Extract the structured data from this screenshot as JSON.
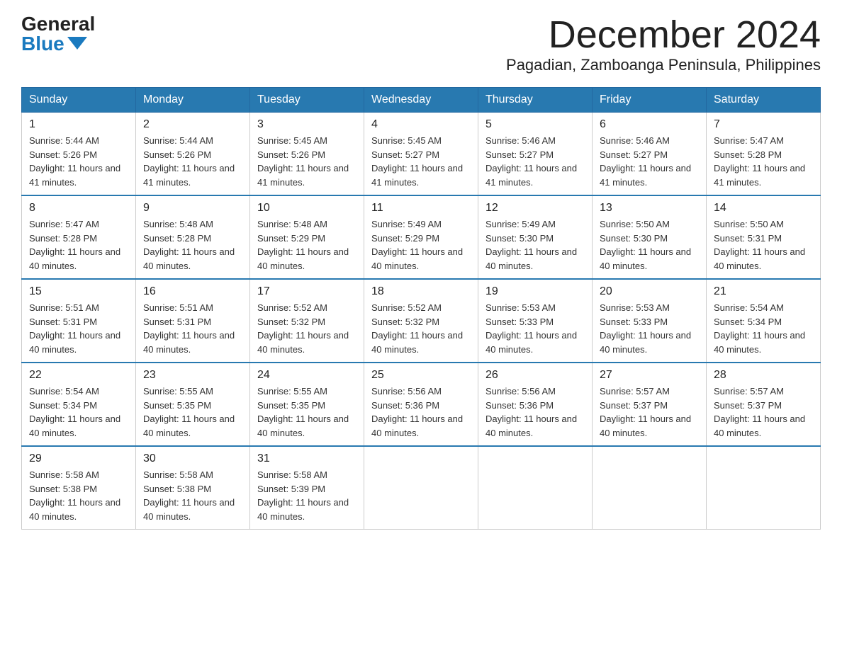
{
  "header": {
    "logo_general": "General",
    "logo_blue": "Blue",
    "month_title": "December 2024",
    "location": "Pagadian, Zamboanga Peninsula, Philippines"
  },
  "columns": [
    "Sunday",
    "Monday",
    "Tuesday",
    "Wednesday",
    "Thursday",
    "Friday",
    "Saturday"
  ],
  "weeks": [
    [
      {
        "day": "1",
        "sunrise": "Sunrise: 5:44 AM",
        "sunset": "Sunset: 5:26 PM",
        "daylight": "Daylight: 11 hours and 41 minutes."
      },
      {
        "day": "2",
        "sunrise": "Sunrise: 5:44 AM",
        "sunset": "Sunset: 5:26 PM",
        "daylight": "Daylight: 11 hours and 41 minutes."
      },
      {
        "day": "3",
        "sunrise": "Sunrise: 5:45 AM",
        "sunset": "Sunset: 5:26 PM",
        "daylight": "Daylight: 11 hours and 41 minutes."
      },
      {
        "day": "4",
        "sunrise": "Sunrise: 5:45 AM",
        "sunset": "Sunset: 5:27 PM",
        "daylight": "Daylight: 11 hours and 41 minutes."
      },
      {
        "day": "5",
        "sunrise": "Sunrise: 5:46 AM",
        "sunset": "Sunset: 5:27 PM",
        "daylight": "Daylight: 11 hours and 41 minutes."
      },
      {
        "day": "6",
        "sunrise": "Sunrise: 5:46 AM",
        "sunset": "Sunset: 5:27 PM",
        "daylight": "Daylight: 11 hours and 41 minutes."
      },
      {
        "day": "7",
        "sunrise": "Sunrise: 5:47 AM",
        "sunset": "Sunset: 5:28 PM",
        "daylight": "Daylight: 11 hours and 41 minutes."
      }
    ],
    [
      {
        "day": "8",
        "sunrise": "Sunrise: 5:47 AM",
        "sunset": "Sunset: 5:28 PM",
        "daylight": "Daylight: 11 hours and 40 minutes."
      },
      {
        "day": "9",
        "sunrise": "Sunrise: 5:48 AM",
        "sunset": "Sunset: 5:28 PM",
        "daylight": "Daylight: 11 hours and 40 minutes."
      },
      {
        "day": "10",
        "sunrise": "Sunrise: 5:48 AM",
        "sunset": "Sunset: 5:29 PM",
        "daylight": "Daylight: 11 hours and 40 minutes."
      },
      {
        "day": "11",
        "sunrise": "Sunrise: 5:49 AM",
        "sunset": "Sunset: 5:29 PM",
        "daylight": "Daylight: 11 hours and 40 minutes."
      },
      {
        "day": "12",
        "sunrise": "Sunrise: 5:49 AM",
        "sunset": "Sunset: 5:30 PM",
        "daylight": "Daylight: 11 hours and 40 minutes."
      },
      {
        "day": "13",
        "sunrise": "Sunrise: 5:50 AM",
        "sunset": "Sunset: 5:30 PM",
        "daylight": "Daylight: 11 hours and 40 minutes."
      },
      {
        "day": "14",
        "sunrise": "Sunrise: 5:50 AM",
        "sunset": "Sunset: 5:31 PM",
        "daylight": "Daylight: 11 hours and 40 minutes."
      }
    ],
    [
      {
        "day": "15",
        "sunrise": "Sunrise: 5:51 AM",
        "sunset": "Sunset: 5:31 PM",
        "daylight": "Daylight: 11 hours and 40 minutes."
      },
      {
        "day": "16",
        "sunrise": "Sunrise: 5:51 AM",
        "sunset": "Sunset: 5:31 PM",
        "daylight": "Daylight: 11 hours and 40 minutes."
      },
      {
        "day": "17",
        "sunrise": "Sunrise: 5:52 AM",
        "sunset": "Sunset: 5:32 PM",
        "daylight": "Daylight: 11 hours and 40 minutes."
      },
      {
        "day": "18",
        "sunrise": "Sunrise: 5:52 AM",
        "sunset": "Sunset: 5:32 PM",
        "daylight": "Daylight: 11 hours and 40 minutes."
      },
      {
        "day": "19",
        "sunrise": "Sunrise: 5:53 AM",
        "sunset": "Sunset: 5:33 PM",
        "daylight": "Daylight: 11 hours and 40 minutes."
      },
      {
        "day": "20",
        "sunrise": "Sunrise: 5:53 AM",
        "sunset": "Sunset: 5:33 PM",
        "daylight": "Daylight: 11 hours and 40 minutes."
      },
      {
        "day": "21",
        "sunrise": "Sunrise: 5:54 AM",
        "sunset": "Sunset: 5:34 PM",
        "daylight": "Daylight: 11 hours and 40 minutes."
      }
    ],
    [
      {
        "day": "22",
        "sunrise": "Sunrise: 5:54 AM",
        "sunset": "Sunset: 5:34 PM",
        "daylight": "Daylight: 11 hours and 40 minutes."
      },
      {
        "day": "23",
        "sunrise": "Sunrise: 5:55 AM",
        "sunset": "Sunset: 5:35 PM",
        "daylight": "Daylight: 11 hours and 40 minutes."
      },
      {
        "day": "24",
        "sunrise": "Sunrise: 5:55 AM",
        "sunset": "Sunset: 5:35 PM",
        "daylight": "Daylight: 11 hours and 40 minutes."
      },
      {
        "day": "25",
        "sunrise": "Sunrise: 5:56 AM",
        "sunset": "Sunset: 5:36 PM",
        "daylight": "Daylight: 11 hours and 40 minutes."
      },
      {
        "day": "26",
        "sunrise": "Sunrise: 5:56 AM",
        "sunset": "Sunset: 5:36 PM",
        "daylight": "Daylight: 11 hours and 40 minutes."
      },
      {
        "day": "27",
        "sunrise": "Sunrise: 5:57 AM",
        "sunset": "Sunset: 5:37 PM",
        "daylight": "Daylight: 11 hours and 40 minutes."
      },
      {
        "day": "28",
        "sunrise": "Sunrise: 5:57 AM",
        "sunset": "Sunset: 5:37 PM",
        "daylight": "Daylight: 11 hours and 40 minutes."
      }
    ],
    [
      {
        "day": "29",
        "sunrise": "Sunrise: 5:58 AM",
        "sunset": "Sunset: 5:38 PM",
        "daylight": "Daylight: 11 hours and 40 minutes."
      },
      {
        "day": "30",
        "sunrise": "Sunrise: 5:58 AM",
        "sunset": "Sunset: 5:38 PM",
        "daylight": "Daylight: 11 hours and 40 minutes."
      },
      {
        "day": "31",
        "sunrise": "Sunrise: 5:58 AM",
        "sunset": "Sunset: 5:39 PM",
        "daylight": "Daylight: 11 hours and 40 minutes."
      },
      null,
      null,
      null,
      null
    ]
  ]
}
